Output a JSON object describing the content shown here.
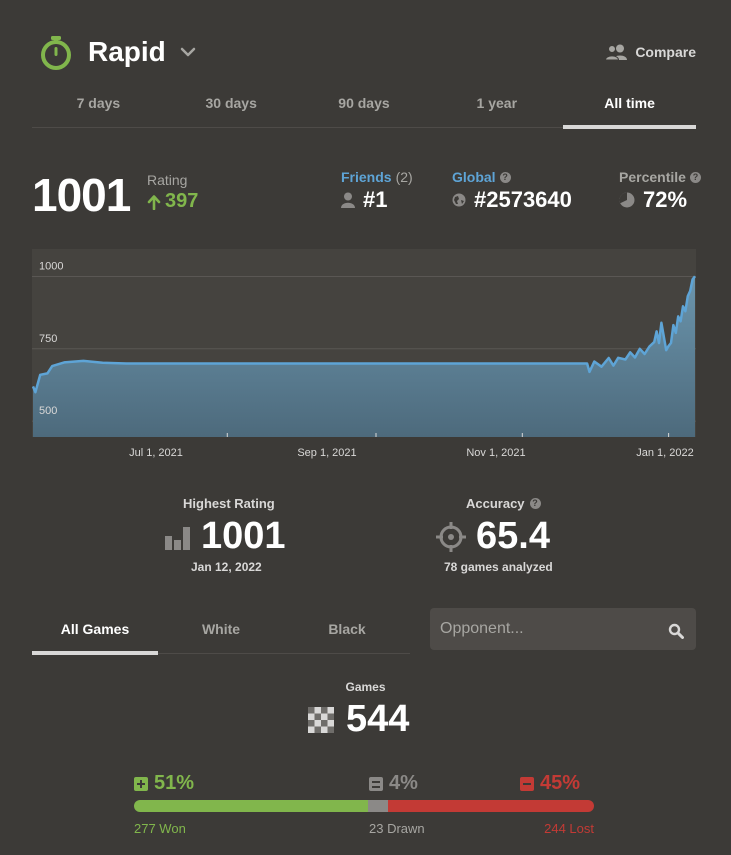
{
  "header": {
    "title": "Rapid",
    "compare_label": "Compare"
  },
  "time_tabs": [
    "7 days",
    "30 days",
    "90 days",
    "1 year",
    "All time"
  ],
  "active_time_tab": "All time",
  "rating": {
    "value": "1001",
    "label": "Rating",
    "change": "397"
  },
  "friends": {
    "label": "Friends",
    "count": "(2)",
    "rank": "#1"
  },
  "global": {
    "label": "Global",
    "rank": "#2573640"
  },
  "percentile": {
    "label": "Percentile",
    "value": "72%"
  },
  "chart_data": {
    "type": "area",
    "y_ticks": [
      "1000",
      "750",
      "500"
    ],
    "x_ticks": [
      "Jul 1, 2021",
      "Sep 1, 2021",
      "Nov 1, 2021",
      "Jan 1, 2022"
    ],
    "ylim": [
      445,
      1095
    ],
    "x_range": [
      "2021-04-11",
      "2022-01-12"
    ],
    "grid": true,
    "points": [
      [
        "2021-04-11",
        620
      ],
      [
        "2021-04-12",
        600
      ],
      [
        "2021-04-14",
        660
      ],
      [
        "2021-04-17",
        665
      ],
      [
        "2021-04-19",
        690
      ],
      [
        "2021-04-24",
        703
      ],
      [
        "2021-05-02",
        708
      ],
      [
        "2021-05-10",
        702
      ],
      [
        "2021-05-20",
        699
      ],
      [
        "2021-06-15",
        699
      ],
      [
        "2021-08-01",
        699
      ],
      [
        "2021-09-15",
        699
      ],
      [
        "2021-10-30",
        699
      ],
      [
        "2021-11-20",
        699
      ],
      [
        "2021-11-28",
        699
      ],
      [
        "2021-11-29",
        670
      ],
      [
        "2021-12-01",
        706
      ],
      [
        "2021-12-04",
        688
      ],
      [
        "2021-12-07",
        718
      ],
      [
        "2021-12-09",
        692
      ],
      [
        "2021-12-11",
        719
      ],
      [
        "2021-12-14",
        713
      ],
      [
        "2021-12-16",
        738
      ],
      [
        "2021-12-18",
        720
      ],
      [
        "2021-12-20",
        750
      ],
      [
        "2021-12-22",
        732
      ],
      [
        "2021-12-24",
        758
      ],
      [
        "2021-12-26",
        773
      ],
      [
        "2021-12-27",
        810
      ],
      [
        "2021-12-28",
        770
      ],
      [
        "2021-12-29",
        840
      ],
      [
        "2021-12-31",
        745
      ],
      [
        "2022-01-01",
        760
      ],
      [
        "2022-01-02",
        770
      ],
      [
        "2022-01-03",
        832
      ],
      [
        "2022-01-04",
        805
      ],
      [
        "2022-01-05",
        862
      ],
      [
        "2022-01-06",
        845
      ],
      [
        "2022-01-07",
        897
      ],
      [
        "2022-01-08",
        880
      ],
      [
        "2022-01-09",
        932
      ],
      [
        "2022-01-10",
        950
      ],
      [
        "2022-01-11",
        990
      ],
      [
        "2022-01-12",
        1001
      ]
    ]
  },
  "highest": {
    "label": "Highest Rating",
    "value": "1001",
    "date": "Jan 12, 2022"
  },
  "accuracy": {
    "label": "Accuracy",
    "value": "65.4",
    "sub": "78 games analyzed"
  },
  "game_tabs": [
    "All Games",
    "White",
    "Black"
  ],
  "opponent_placeholder": "Opponent...",
  "games": {
    "label": "Games",
    "count": "544"
  },
  "wdl": {
    "won_pct": "51%",
    "drawn_pct": "4%",
    "lost_pct": "45%",
    "won": "277 Won",
    "drawn": "23 Drawn",
    "lost": "244 Lost",
    "won_n": 277,
    "drawn_n": 23,
    "lost_n": 244
  },
  "colors": {
    "win": "#81b64c",
    "draw": "#8b8987",
    "loss": "#c33a35",
    "line": "#5ea4d6",
    "accent_green": "#81b64c"
  }
}
